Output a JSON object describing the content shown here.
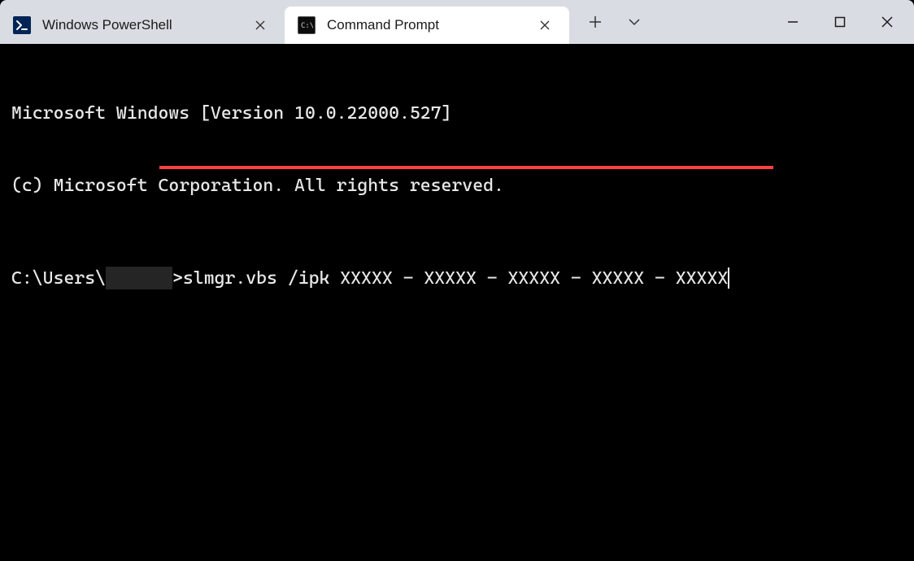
{
  "tabs": [
    {
      "label": "Windows PowerShell",
      "icon": "powershell",
      "active": false
    },
    {
      "label": "Command Prompt",
      "icon": "cmd",
      "active": true
    }
  ],
  "terminal": {
    "header_line1": "Microsoft Windows [Version 10.0.22000.527]",
    "header_line2": "(c) Microsoft Corporation. All rights reserved.",
    "prompt_prefix": "C:\\Users\\",
    "prompt_suffix": ">",
    "command": "slmgr.vbs /ipk XXXXX - XXXXX - XXXXX - XXXXX - XXXXX"
  }
}
